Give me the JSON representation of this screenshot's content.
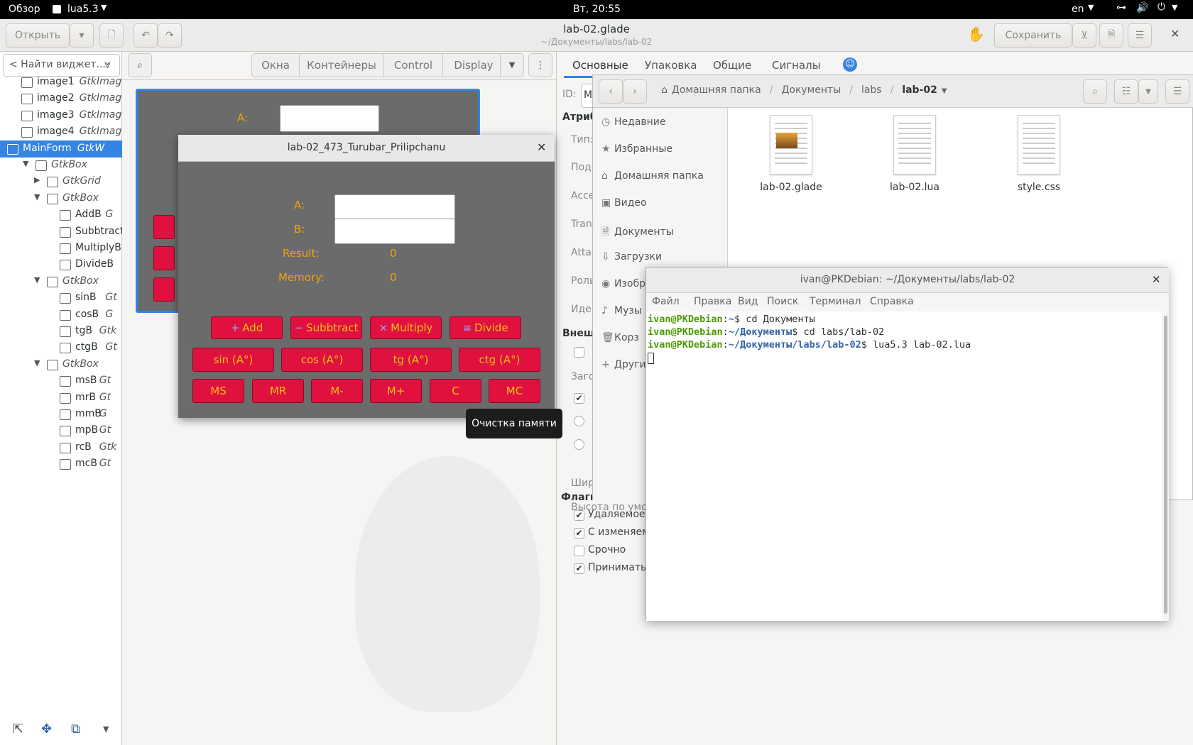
{
  "topbar": {
    "activities": "Обзор",
    "app": "lua5.3",
    "clock": "Вт, 20:55",
    "lang": "en"
  },
  "glade": {
    "open": "Открыть",
    "title": "lab-02.glade",
    "path": "~/Документы/labs/lab-02",
    "save": "Сохранить",
    "search_placeholder": "< Найти виджет...",
    "palette_tabs": [
      "Окна",
      "Контейнеры",
      "Control",
      "Display"
    ],
    "tree": [
      {
        "name": "image1",
        "type": "GtkImag",
        "icon": "image-icon"
      },
      {
        "name": "image2",
        "type": "GtkImag",
        "icon": "image-icon"
      },
      {
        "name": "image3",
        "type": "GtkImag",
        "icon": "image-icon"
      },
      {
        "name": "image4",
        "type": "GtkImag",
        "icon": "image-icon"
      },
      {
        "name": "MainForm",
        "type": "GtkW",
        "icon": "window-icon",
        "selected": true
      },
      {
        "name": "GtkBox",
        "type": "",
        "icon": "box-icon"
      },
      {
        "name": "GtkGrid",
        "type": "",
        "icon": "grid-icon"
      },
      {
        "name": "GtkBox",
        "type": "",
        "icon": "box-icon"
      },
      {
        "name": "AddB",
        "type": "G",
        "icon": "button-icon"
      },
      {
        "name": "Subbtract",
        "type": "",
        "icon": "button-icon"
      },
      {
        "name": "MultiplyB",
        "type": "",
        "icon": "button-icon"
      },
      {
        "name": "DivideB",
        "type": "",
        "icon": "button-icon"
      },
      {
        "name": "GtkBox",
        "type": "",
        "icon": "box-icon"
      },
      {
        "name": "sinB",
        "type": "Gt",
        "icon": "button-icon"
      },
      {
        "name": "cosB",
        "type": "G",
        "icon": "button-icon"
      },
      {
        "name": "tgB",
        "type": "Gtk",
        "icon": "button-icon"
      },
      {
        "name": "ctgB",
        "type": "Gt",
        "icon": "button-icon"
      },
      {
        "name": "GtkBox",
        "type": "",
        "icon": "box-icon"
      },
      {
        "name": "msB",
        "type": "Gt",
        "icon": "button-icon"
      },
      {
        "name": "mrB",
        "type": "Gt",
        "icon": "button-icon"
      },
      {
        "name": "mmB",
        "type": "G",
        "icon": "button-icon"
      },
      {
        "name": "mpB",
        "type": "Gt",
        "icon": "button-icon"
      },
      {
        "name": "rcB",
        "type": "Gtk",
        "icon": "button-icon"
      },
      {
        "name": "mcB",
        "type": "Gt",
        "icon": "button-icon"
      }
    ],
    "design_label_a": "A:",
    "prop_tabs": [
      "Основные",
      "Упаковка",
      "Общие",
      "Сигналы"
    ],
    "prop_labels": [
      "ID:",
      "Атриб",
      "Тип:",
      "Подс",
      "Acce",
      "Tran",
      "Attac",
      "Роль",
      "Иден",
      "Внеш",
      "Заго",
      "Шир",
      "Высота по умол"
    ],
    "id_value": "M",
    "flags_title": "Флаги окна",
    "flags": [
      {
        "label": "Удаляемое",
        "checked": true
      },
      {
        "label": "С изменяем",
        "checked": true
      },
      {
        "label": "Срочно",
        "checked": false
      },
      {
        "label": "Принимать",
        "checked": true
      }
    ]
  },
  "calc": {
    "title": "lab-02_473_Turubar_Prilipchanu",
    "label_a": "A:",
    "label_b": "B:",
    "label_result": "Result:",
    "result_value": "0",
    "label_memory": "Memory:",
    "memory_value": "0",
    "ops": [
      {
        "icon": "+",
        "label": "Add"
      },
      {
        "icon": "−",
        "label": "Subbtract"
      },
      {
        "icon": "×",
        "label": "Multiply"
      },
      {
        "icon": "≡",
        "label": "Divide"
      }
    ],
    "trig": [
      "sin (A°)",
      "cos (A°)",
      "tg (A°)",
      "ctg (A°)"
    ],
    "memory": [
      "MS",
      "MR",
      "M-",
      "M+",
      "C",
      "MC"
    ],
    "tooltip": "Очистка памяти"
  },
  "files": {
    "breadcrumb": [
      "Домашняя папка",
      "Документы",
      "labs",
      "lab-02"
    ],
    "sidebar": [
      "Недавние",
      "Избранные",
      "Домашняя папка",
      "Видео",
      "Документы",
      "Загрузки",
      "Изобр",
      "Музы",
      "Корз",
      "Други"
    ],
    "items": [
      "lab-02.glade",
      "lab-02.lua",
      "style.css"
    ]
  },
  "terminal": {
    "title": "ivan@PKDebian: ~/Документы/labs/lab-02",
    "menu": [
      "Файл",
      "Правка",
      "Вид",
      "Поиск",
      "Терминал",
      "Справка"
    ],
    "lines": [
      {
        "user": "ivan@PKDebian",
        "path": "~",
        "cmd": "cd Документы"
      },
      {
        "user": "ivan@PKDebian",
        "path": "~/Документы",
        "cmd": "cd labs/lab-02"
      },
      {
        "user": "ivan@PKDebian",
        "path": "~/Документы/labs/lab-02",
        "cmd": "lua5.3 lab-02.lua"
      }
    ]
  }
}
